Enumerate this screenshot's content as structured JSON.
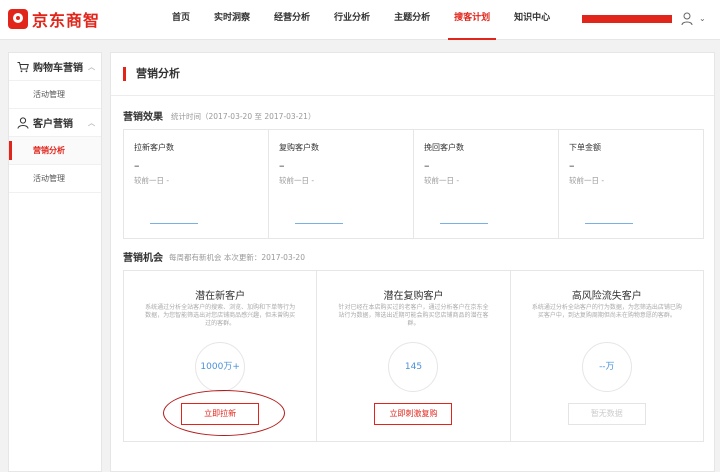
{
  "brand": {
    "name": "京东商智",
    "accent": "#e1251b"
  },
  "nav": {
    "items": [
      {
        "label": "首页",
        "active": false
      },
      {
        "label": "实时洞察",
        "active": false
      },
      {
        "label": "经营分析",
        "active": false
      },
      {
        "label": "行业分析",
        "active": false
      },
      {
        "label": "主题分析",
        "active": false
      },
      {
        "label": "搜客计划",
        "active": true
      },
      {
        "label": "知识中心",
        "active": false
      }
    ],
    "user_chevron": "⌄"
  },
  "sidebar": {
    "groups": [
      {
        "label": "购物车营销",
        "icon": "cart-icon",
        "items": [
          {
            "label": "活动管理",
            "active": false
          }
        ]
      },
      {
        "label": "客户营销",
        "icon": "user-icon",
        "items": [
          {
            "label": "营销分析",
            "active": true
          },
          {
            "label": "活动管理",
            "active": false
          }
        ]
      }
    ],
    "caret": "︿"
  },
  "main": {
    "title": "营销分析",
    "effect": {
      "title": "营销效果",
      "subtitle": "统计时间（2017-03-20 至 2017-03-21）",
      "kpis": [
        {
          "label": "拉新客户数",
          "value": "–",
          "compare": "较前一日   -"
        },
        {
          "label": "复购客户数",
          "value": "–",
          "compare": "较前一日   -"
        },
        {
          "label": "挽回客户数",
          "value": "–",
          "compare": "较前一日   -"
        },
        {
          "label": "下单金额",
          "value": "–",
          "compare": "较前一日   -"
        }
      ]
    },
    "opportunity": {
      "title": "营销机会",
      "subtitle": "每周都有新机会 本次更新：2017-03-20",
      "cards": [
        {
          "title": "潜在新客户",
          "desc": "系统通过分析全站客户的搜索、浏览、加购和下单等行为数据，为您智能筛选出对您店铺商品感兴趣，但未曾购买过的客群。",
          "value": "1000万+",
          "button": "立即拉新",
          "disabled": false
        },
        {
          "title": "潜在复购客户",
          "desc": "针对已经在本店购买过的老客户，通过分析客户在京东全站行为数据，筛选出近期可能会购买您店铺商品的潜在客群。",
          "value": "145",
          "button": "立即刺激复购",
          "disabled": false
        },
        {
          "title": "高风险流失客户",
          "desc": "系统通过分析全站客户的行为数据，为您筛选出店铺已购买客户中，到达复购周期但尚未在购物意愿的客群。",
          "value": "--万",
          "button": "暂无数据",
          "disabled": true
        }
      ]
    }
  }
}
